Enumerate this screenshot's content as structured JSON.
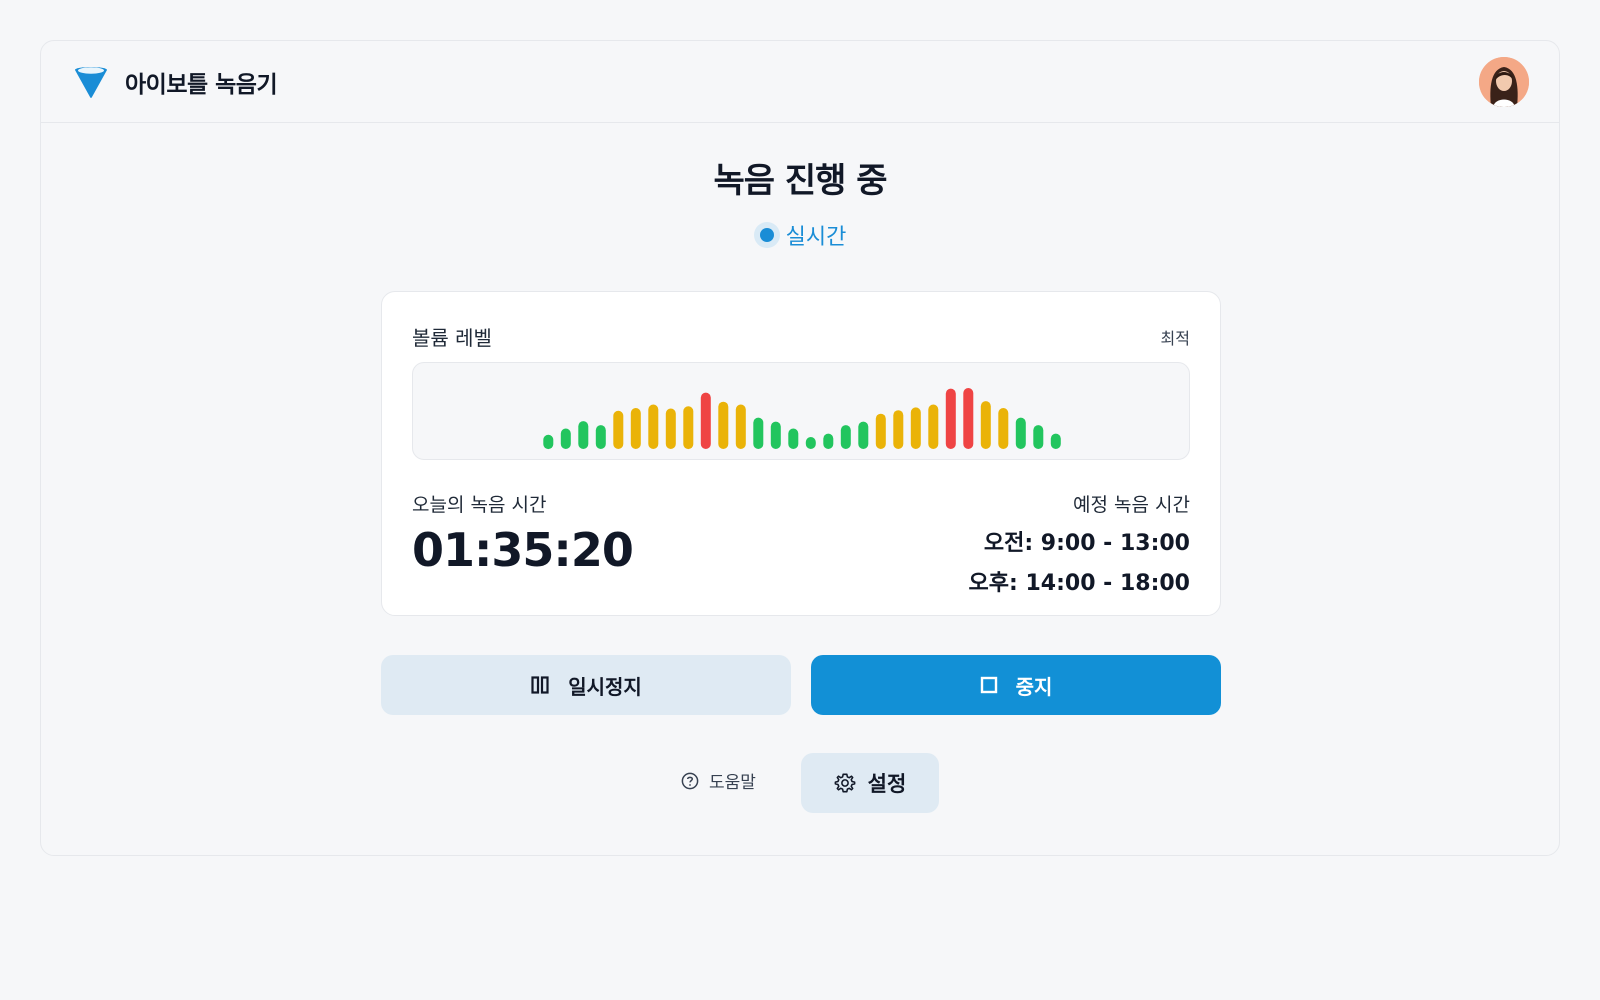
{
  "app": {
    "title": "아이보틀 녹음기"
  },
  "page": {
    "title": "녹음 진행 중",
    "live_label": "실시간"
  },
  "volume": {
    "label": "볼륨 레벨",
    "status": "최적",
    "levels": [
      0.25,
      0.36,
      0.49,
      0.42,
      0.67,
      0.72,
      0.78,
      0.71,
      0.75,
      0.99,
      0.83,
      0.78,
      0.55,
      0.48,
      0.36,
      0.21,
      0.27,
      0.42,
      0.48,
      0.62,
      0.68,
      0.73,
      0.78,
      1.06,
      1.07,
      0.84,
      0.72,
      0.55,
      0.42,
      0.27
    ],
    "level_colors": [
      "g",
      "g",
      "g",
      "g",
      "y",
      "y",
      "y",
      "y",
      "y",
      "r",
      "y",
      "y",
      "g",
      "g",
      "g",
      "g",
      "g",
      "g",
      "g",
      "y",
      "y",
      "y",
      "y",
      "r",
      "r",
      "y",
      "y",
      "g",
      "g",
      "g"
    ],
    "colors": {
      "g": "#22c55e",
      "y": "#eab308",
      "r": "#ef4444"
    }
  },
  "today": {
    "label": "오늘의 녹음 시간",
    "time": "01:35:20"
  },
  "schedule": {
    "label": "예정 녹음 시간",
    "am": "오전: 9:00 - 13:00",
    "pm": "오후: 14:00 - 18:00"
  },
  "buttons": {
    "pause": "일시정지",
    "stop": "중지",
    "help": "도움말",
    "settings": "설정"
  },
  "theme": {
    "accent": "#1290d6",
    "soft": "#dfeaf3"
  }
}
